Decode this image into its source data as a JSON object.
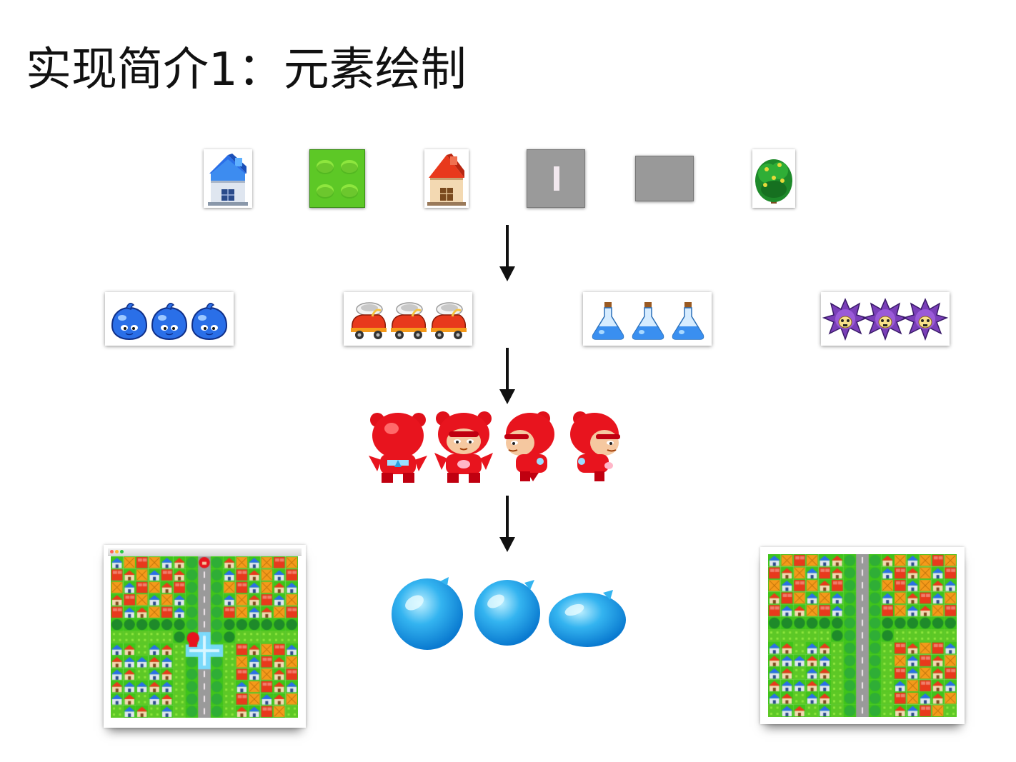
{
  "title": "实现简介1：元素绘制",
  "tiles": [
    {
      "name": "blue-house-tile-icon"
    },
    {
      "name": "green-brick-tile-icon"
    },
    {
      "name": "red-house-tile-icon"
    },
    {
      "name": "gray-road-tile-icon"
    },
    {
      "name": "gray-block-tile-icon"
    },
    {
      "name": "tree-tile-icon"
    }
  ],
  "items": [
    {
      "name": "water-bomb-item-icon",
      "color": "#2a6fe8"
    },
    {
      "name": "speed-shoe-item-icon",
      "color": "#e8391c"
    },
    {
      "name": "potion-item-icon",
      "color": "#4aa6f0"
    },
    {
      "name": "spike-bomb-item-icon",
      "color": "#7a3fb8"
    }
  ],
  "characters": [
    {
      "name": "character-back-icon"
    },
    {
      "name": "character-front-icon"
    },
    {
      "name": "character-side-left-icon"
    },
    {
      "name": "character-side-right-icon"
    }
  ],
  "bubbles": [
    {
      "name": "water-bubble-large-icon"
    },
    {
      "name": "water-bubble-medium-icon"
    },
    {
      "name": "water-bubble-squashed-icon"
    }
  ],
  "maps": [
    {
      "name": "game-map-screenshot-playing"
    },
    {
      "name": "game-map-screenshot-empty"
    }
  ],
  "colors": {
    "arrow": "#111111",
    "grass": "#3fc41a",
    "brick_red": "#e8391c",
    "brick_orange": "#f59a1a",
    "road": "#9a9a9a",
    "house_blue": "#2a6fe8",
    "tree": "#1e8a2a"
  }
}
